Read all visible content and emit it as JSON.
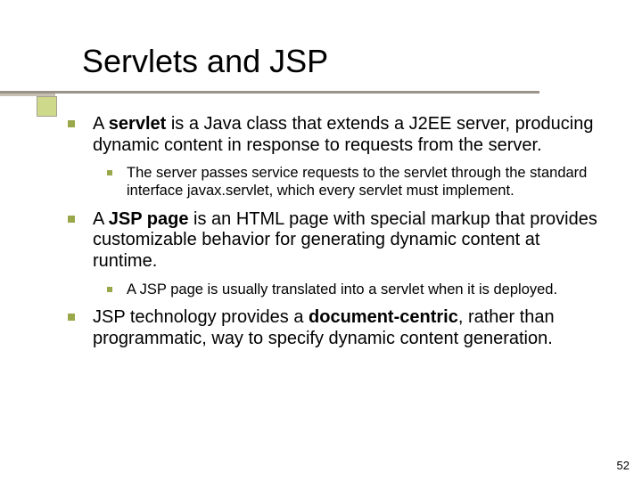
{
  "title": "Servlets and JSP",
  "bullets": [
    {
      "pre": "A ",
      "term": "servlet",
      "post": " is a Java class that extends a J2EE server, producing dynamic content in response to requests from the server.",
      "sub": [
        "The server passes service requests to the servlet through the standard interface javax.servlet, which every servlet must implement."
      ]
    },
    {
      "pre": "A ",
      "term": "JSP page",
      "post": " is an HTML page with special markup that provides customizable behavior for generating dynamic content at runtime.",
      "sub": [
        "A JSP page is usually translated into a servlet when it is deployed."
      ]
    },
    {
      "pre": "JSP technology provides a ",
      "term": "document-centric",
      "post": ", rather than programmatic, way to specify dynamic content generation.",
      "sub": []
    }
  ],
  "page_number": "52"
}
